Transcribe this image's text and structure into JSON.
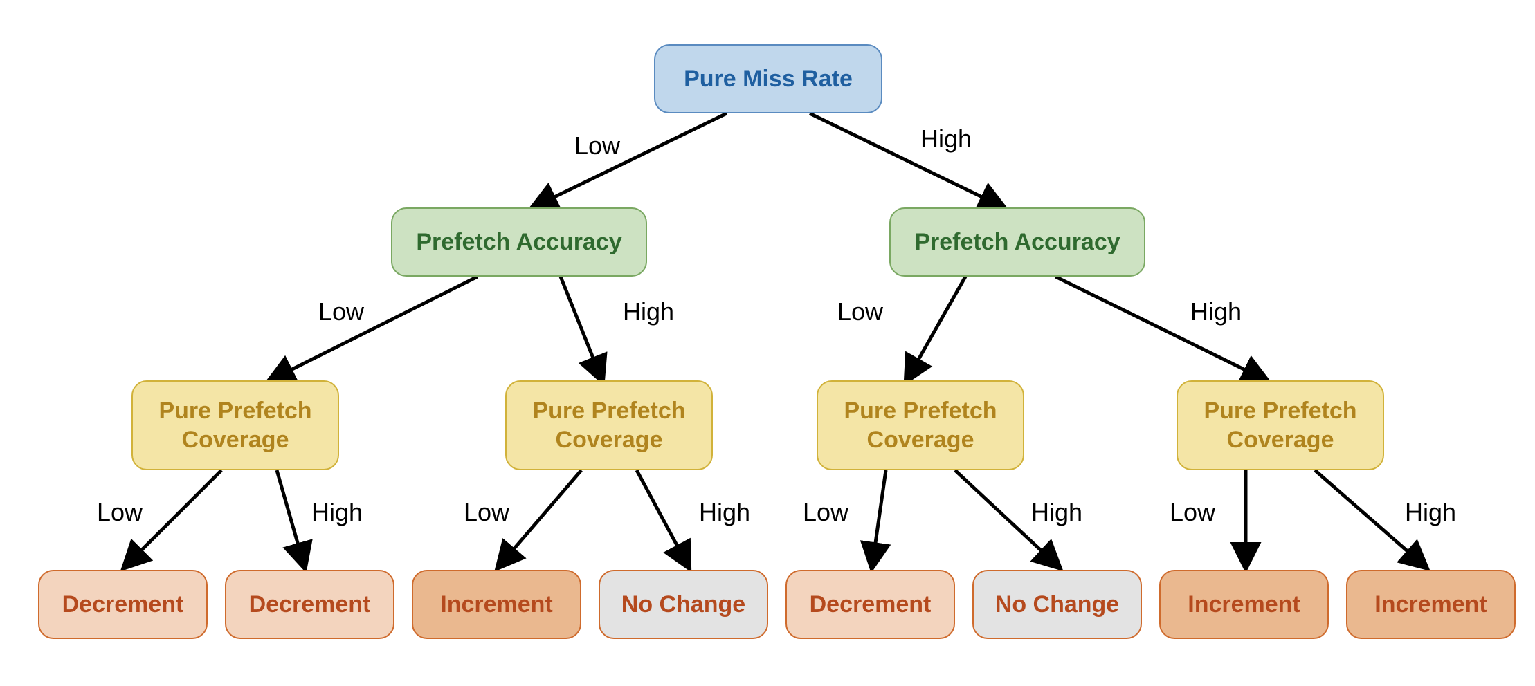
{
  "labels": {
    "low": "Low",
    "high": "High"
  },
  "nodes": {
    "root": "Pure Miss Rate",
    "accuracy": "Prefetch Accuracy",
    "coverage": "Pure Prefetch Coverage",
    "decrement": "Decrement",
    "increment": "Increment",
    "nochange": "No Change"
  },
  "tree": {
    "root": "Pure Miss Rate",
    "branches": {
      "Low": {
        "node": "Prefetch Accuracy",
        "branches": {
          "Low": {
            "node": "Pure Prefetch Coverage",
            "branches": {
              "Low": "Decrement",
              "High": "Decrement"
            }
          },
          "High": {
            "node": "Pure Prefetch Coverage",
            "branches": {
              "Low": "Increment",
              "High": "No Change"
            }
          }
        }
      },
      "High": {
        "node": "Prefetch Accuracy",
        "branches": {
          "Low": {
            "node": "Pure Prefetch Coverage",
            "branches": {
              "Low": "Decrement",
              "High": "No Change"
            }
          },
          "High": {
            "node": "Pure Prefetch Coverage",
            "branches": {
              "Low": "Increment",
              "High": "Increment"
            }
          }
        }
      }
    }
  }
}
